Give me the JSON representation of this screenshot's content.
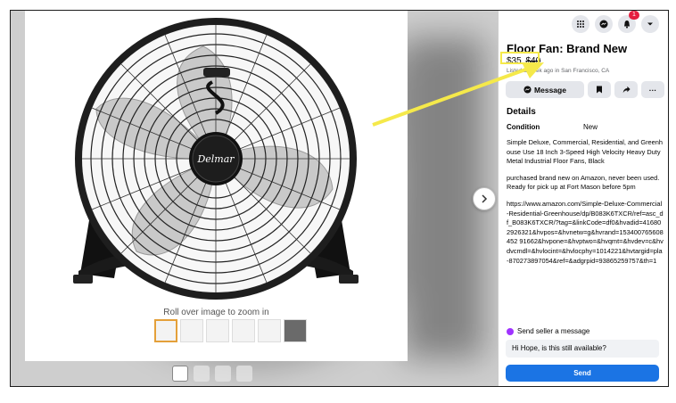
{
  "listing": {
    "title": "Floor Fan: Brand New",
    "price": "$35",
    "price_old": "$40",
    "listed_text": "Listed a week ago in San Francisco, CA",
    "details_heading": "Details",
    "condition_label": "Condition",
    "condition_value": "New",
    "description": [
      "Simple Deluxe, Commercial, Residential, and Greenhouse Use 18 Inch 3-Speed High Velocity Heavy Duty Metal Industrial Floor Fans, Black",
      "purchased brand new on Amazon, never been used. Ready for pick up at Fort Mason before 5pm",
      "https://www.amazon.com/Simple-Deluxe-Commercial-Residential-Greenhouse/dp/B083K6TXCR/ref=asc_df_B083K6TXCR/?tag=&linkCode=df0&hvadid=416802926321&hvpos=&hvnetw=g&hvrand=153400765608452 91662&hvpone=&hvptwo=&hvqmt=&hvdev=c&hvdvcmdl=&hvlocint=&hvlocphy=1014221&hvtargid=pla-870273897054&ref=&adgrpid=93865259757&th=1"
    ]
  },
  "actions": {
    "message_label": "Message",
    "save_icon": "bookmark-icon",
    "share_icon": "share-icon",
    "more_label": "···"
  },
  "media": {
    "zoom_hint": "Roll over image to zoom in",
    "brand_on_fan": "Delmar"
  },
  "message_box": {
    "heading": "Send seller a message",
    "input_value": "Hi Hope, is this still available?",
    "send_label": "Send"
  },
  "topbar": {
    "notification_count": "1",
    "icons": [
      "menu-grid-icon",
      "messenger-icon",
      "bell-icon",
      "chevron-down-icon"
    ]
  },
  "colors": {
    "accent": "#1b74e4",
    "highlight": "#f5e94a",
    "badge": "#e41e3f"
  }
}
